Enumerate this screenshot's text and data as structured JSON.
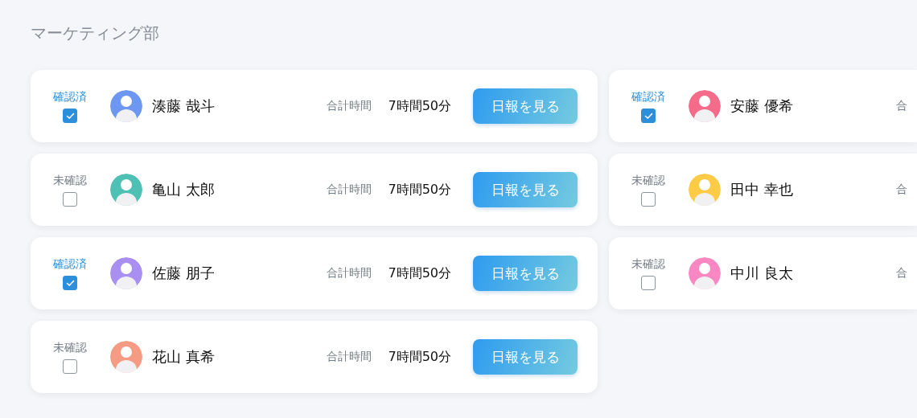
{
  "department": {
    "title": "マーケティング部"
  },
  "columns": [
    {
      "cards": [
        {
          "status_label": "確認済",
          "checked": true,
          "color": "#6e97f2",
          "name": "湊藤 哉斗",
          "total_label": "合計時間",
          "total_time": "7時間50分",
          "button": "日報を見る"
        },
        {
          "status_label": "未確認",
          "checked": false,
          "color": "#4fc1b4",
          "name": "亀山 太郎",
          "total_label": "合計時間",
          "total_time": "7時間50分",
          "button": "日報を見る"
        },
        {
          "status_label": "確認済",
          "checked": true,
          "color": "#a98ff2",
          "name": "佐藤 朋子",
          "total_label": "合計時間",
          "total_time": "7時間50分",
          "button": "日報を見る"
        },
        {
          "status_label": "未確認",
          "checked": false,
          "color": "#f59a83",
          "name": "花山 真希",
          "total_label": "合計時間",
          "total_time": "7時間50分",
          "button": "日報を見る"
        }
      ]
    },
    {
      "cards": [
        {
          "status_label": "確認済",
          "checked": true,
          "color": "#f56b8a",
          "name": "安藤 優希",
          "total_label": "合"
        },
        {
          "status_label": "未確認",
          "checked": false,
          "color": "#fdcb45",
          "name": "田中 幸也",
          "total_label": "合"
        },
        {
          "status_label": "未確認",
          "checked": false,
          "color": "#f887c4",
          "name": "中川 良太",
          "total_label": "合"
        }
      ]
    }
  ]
}
